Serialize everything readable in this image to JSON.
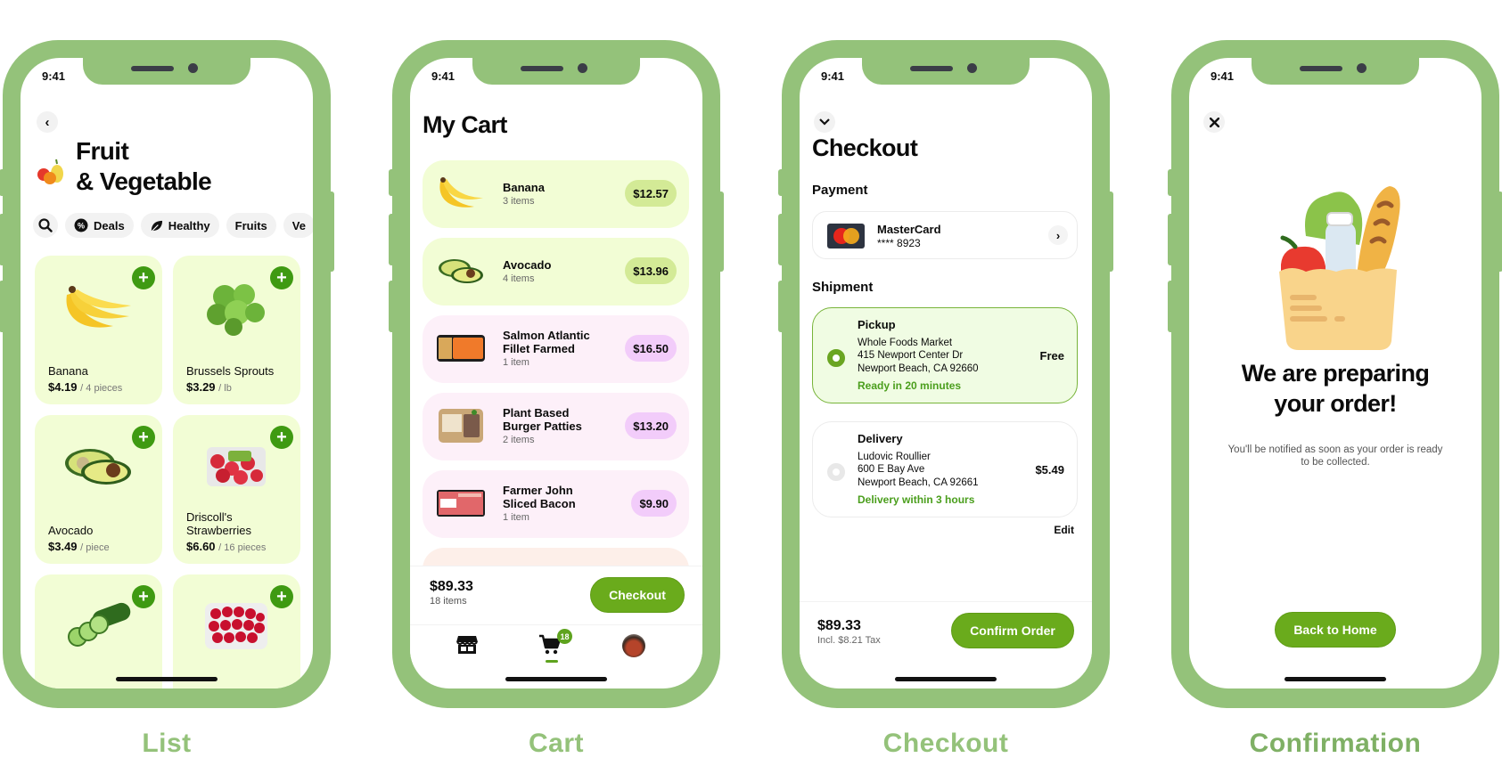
{
  "status_time": "9:41",
  "captions": [
    "List",
    "Cart",
    "Checkout",
    "Confirmation"
  ],
  "colors": {
    "frame": "#94c27a",
    "accent_green": "#6aab1c",
    "tile_green": "#f2fdd5",
    "tile_pink": "#fdf0f9",
    "price_pill_green": "#d3ea96",
    "price_pill_pink": "#f2ccfa"
  },
  "list": {
    "back_icon": "chevron-left-icon",
    "title_line1": "Fruit",
    "title_line2": "& Vegetable",
    "category_icon": "fruit-emoji-icon",
    "chips": [
      {
        "label": "",
        "icon": "search-icon"
      },
      {
        "label": "Deals",
        "icon": "percent-badge-icon"
      },
      {
        "label": "Healthy",
        "icon": "leaf-icon"
      },
      {
        "label": "Fruits",
        "icon": ""
      },
      {
        "label": "Ve",
        "icon": ""
      }
    ],
    "products": [
      {
        "name": "Banana",
        "price": "$4.19",
        "unit": "/ 4 pieces",
        "image": "banana"
      },
      {
        "name": "Brussels Sprouts",
        "price": "$3.29",
        "unit": "/ lb",
        "image": "brussels-sprouts"
      },
      {
        "name": "Avocado",
        "price": "$3.49",
        "unit": "/ piece",
        "image": "avocado"
      },
      {
        "name": "Driscoll's Strawberries",
        "price": "$6.60",
        "unit": "/ 16 pieces",
        "image": "strawberries"
      },
      {
        "name": "",
        "price": "",
        "unit": "",
        "image": "cucumber"
      },
      {
        "name": "",
        "price": "",
        "unit": "",
        "image": "raspberries"
      }
    ],
    "add_label": "+"
  },
  "cart": {
    "title": "My Cart",
    "items": [
      {
        "name": "Banana",
        "qty": "3 items",
        "price": "$12.57",
        "tone": "green"
      },
      {
        "name": "Avocado",
        "qty": "4 items",
        "price": "$13.96",
        "tone": "green"
      },
      {
        "name": "Salmon Atlantic Fillet Farmed",
        "qty": "1 item",
        "price": "$16.50",
        "tone": "pink"
      },
      {
        "name": "Plant Based Burger Patties",
        "qty": "2 items",
        "price": "$13.20",
        "tone": "pink"
      },
      {
        "name": "Farmer John Sliced Bacon",
        "qty": "1 item",
        "price": "$9.90",
        "tone": "pink"
      }
    ],
    "total": "$89.33",
    "count": "18 items",
    "checkout_label": "Checkout",
    "tabs": [
      {
        "name": "store",
        "icon": "storefront-icon"
      },
      {
        "name": "cart",
        "icon": "cart-icon",
        "badge": "18",
        "active": true
      },
      {
        "name": "profile",
        "icon": "avatar"
      }
    ]
  },
  "checkout": {
    "collapse_icon": "chevron-down-icon",
    "title": "Checkout",
    "payment_label": "Payment",
    "card_name": "MasterCard",
    "card_number": "**** 8923",
    "shipment_label": "Shipment",
    "options": [
      {
        "type": "Pickup",
        "line1": "Whole Foods Market",
        "line2": "415 Newport Center Dr",
        "line3": "Newport Beach, CA 92660",
        "eta": "Ready in 20 minutes",
        "price": "Free",
        "selected": true
      },
      {
        "type": "Delivery",
        "line1": "Ludovic Roullier",
        "line2": "600 E Bay Ave",
        "line3": "Newport Beach, CA 92661",
        "eta": "Delivery within 3 hours",
        "price": "$5.49",
        "selected": false
      }
    ],
    "edit_label": "Edit",
    "total": "$89.33",
    "tax_note": "Incl. $8.21 Tax",
    "confirm_label": "Confirm Order"
  },
  "confirmation": {
    "close_icon": "close-icon",
    "title_line1": "We are preparing",
    "title_line2": "your order!",
    "subtitle": "You'll be notified as soon as your order is ready to be collected.",
    "button_label": "Back to Home"
  }
}
